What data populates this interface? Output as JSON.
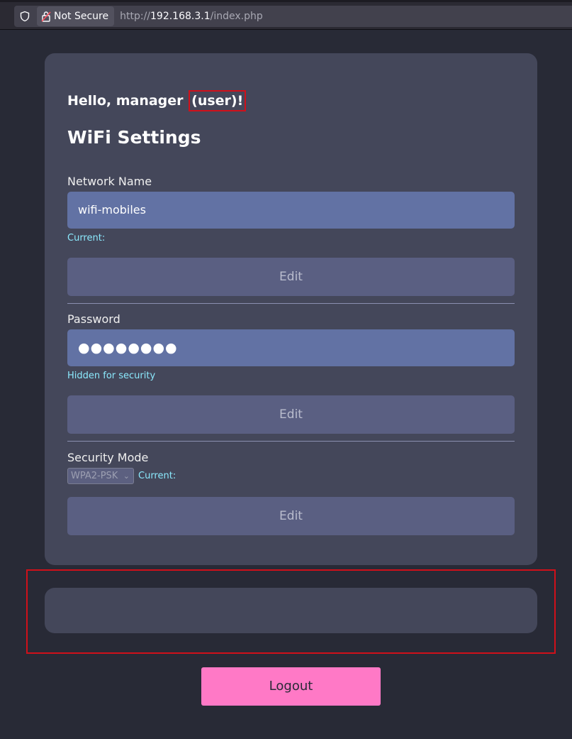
{
  "browser": {
    "security_label": "Not Secure",
    "url_scheme": "http://",
    "url_host": "192.168.3.1",
    "url_path": "/index.php"
  },
  "greeting": {
    "prefix": "Hello, manager ",
    "role": "(user)",
    "suffix": "!"
  },
  "page_title": "WiFi Settings",
  "network_name": {
    "label": "Network Name",
    "value": "wifi-mobiles",
    "hint": "Current:",
    "edit_label": "Edit"
  },
  "password": {
    "label": "Password",
    "value": "●●●●●●●●",
    "hint": "Hidden for security",
    "edit_label": "Edit"
  },
  "security_mode": {
    "label": "Security Mode",
    "selected": "WPA2-PSK",
    "hint": "Current:",
    "edit_label": "Edit"
  },
  "logout_label": "Logout",
  "colors": {
    "background": "#282a36",
    "card": "#44475a",
    "input": "#6272a4",
    "accent": "#ff79c6",
    "hint": "#8be9fd",
    "highlight": "#d0101a"
  }
}
